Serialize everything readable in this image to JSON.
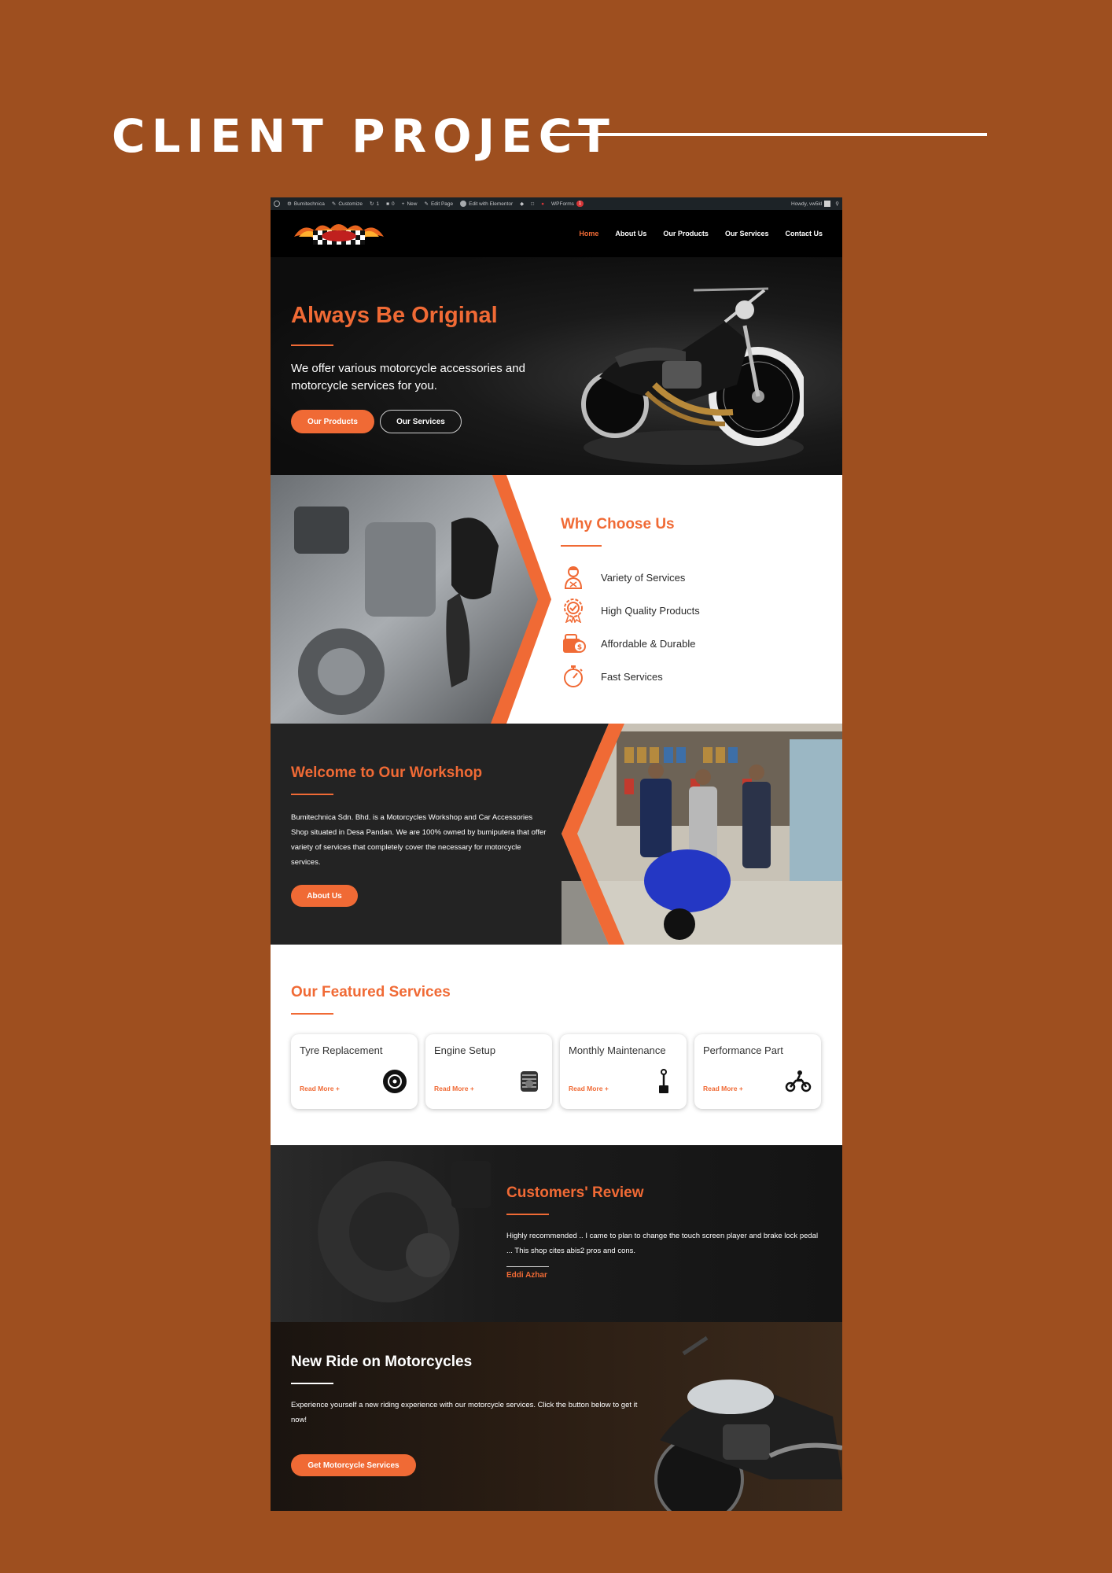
{
  "banner": {
    "title": "CLIENT PROJECT"
  },
  "colors": {
    "background": "#9e4f1f",
    "accent": "#f06a35",
    "dark": "#232323",
    "admin_bar": "#1d2327"
  },
  "admin_bar": {
    "site_name": "Bumitechnica",
    "customize": "Customize",
    "updates_count": "1",
    "comments_count": "0",
    "new": "New",
    "edit_page": "Edit Page",
    "edit_elementor": "Edit with Elementor",
    "wpforms": "WPForms",
    "wpforms_badge": "1",
    "howdy": "Howdy, vw5kl"
  },
  "nav": {
    "items": [
      "Home",
      "About Us",
      "Our Products",
      "Our Services",
      "Contact Us"
    ],
    "active": "Home"
  },
  "hero": {
    "title": "Always Be Original",
    "text": "We offer various motorcycle accessories and motorcycle services for you.",
    "primary_button": "Our Products",
    "secondary_button": "Our Services"
  },
  "why": {
    "title": "Why Choose Us",
    "items": [
      {
        "label": "Variety of Services",
        "icon": "mechanic-icon"
      },
      {
        "label": "High Quality Products",
        "icon": "quality-badge-icon"
      },
      {
        "label": "Affordable & Durable",
        "icon": "wallet-icon"
      },
      {
        "label": "Fast Services",
        "icon": "stopwatch-icon"
      }
    ]
  },
  "workshop": {
    "title": "Welcome to Our Workshop",
    "text": "Bumitechnica Sdn. Bhd. is a Motorcycles Workshop and Car Accessories Shop situated in Desa Pandan. We are 100% owned by bumiputera that offer variety of services that completely cover the necessary for motorcycle services.",
    "button": "About Us"
  },
  "featured": {
    "title": "Our Featured Services",
    "cards": [
      {
        "title": "Tyre Replacement",
        "link": "Read More +",
        "icon": "tyre-icon"
      },
      {
        "title": "Engine Setup",
        "link": "Read More +",
        "icon": "engine-icon"
      },
      {
        "title": "Monthly Maintenance",
        "link": "Read More +",
        "icon": "piston-icon"
      },
      {
        "title": "Performance Part",
        "link": "Read More +",
        "icon": "dirtbike-icon"
      }
    ]
  },
  "review": {
    "title": "Customers' Review",
    "text": "Highly recommended .. I came to plan to change the touch screen player and brake lock pedal ... This shop cites abis2 pros and cons.",
    "author": "Eddi Azhar"
  },
  "ride": {
    "title": "New Ride on Motorcycles",
    "text": "Experience yourself a new riding experience with our motorcycle services. Click the button below to get it now!",
    "button": "Get Motorcycle Services"
  }
}
